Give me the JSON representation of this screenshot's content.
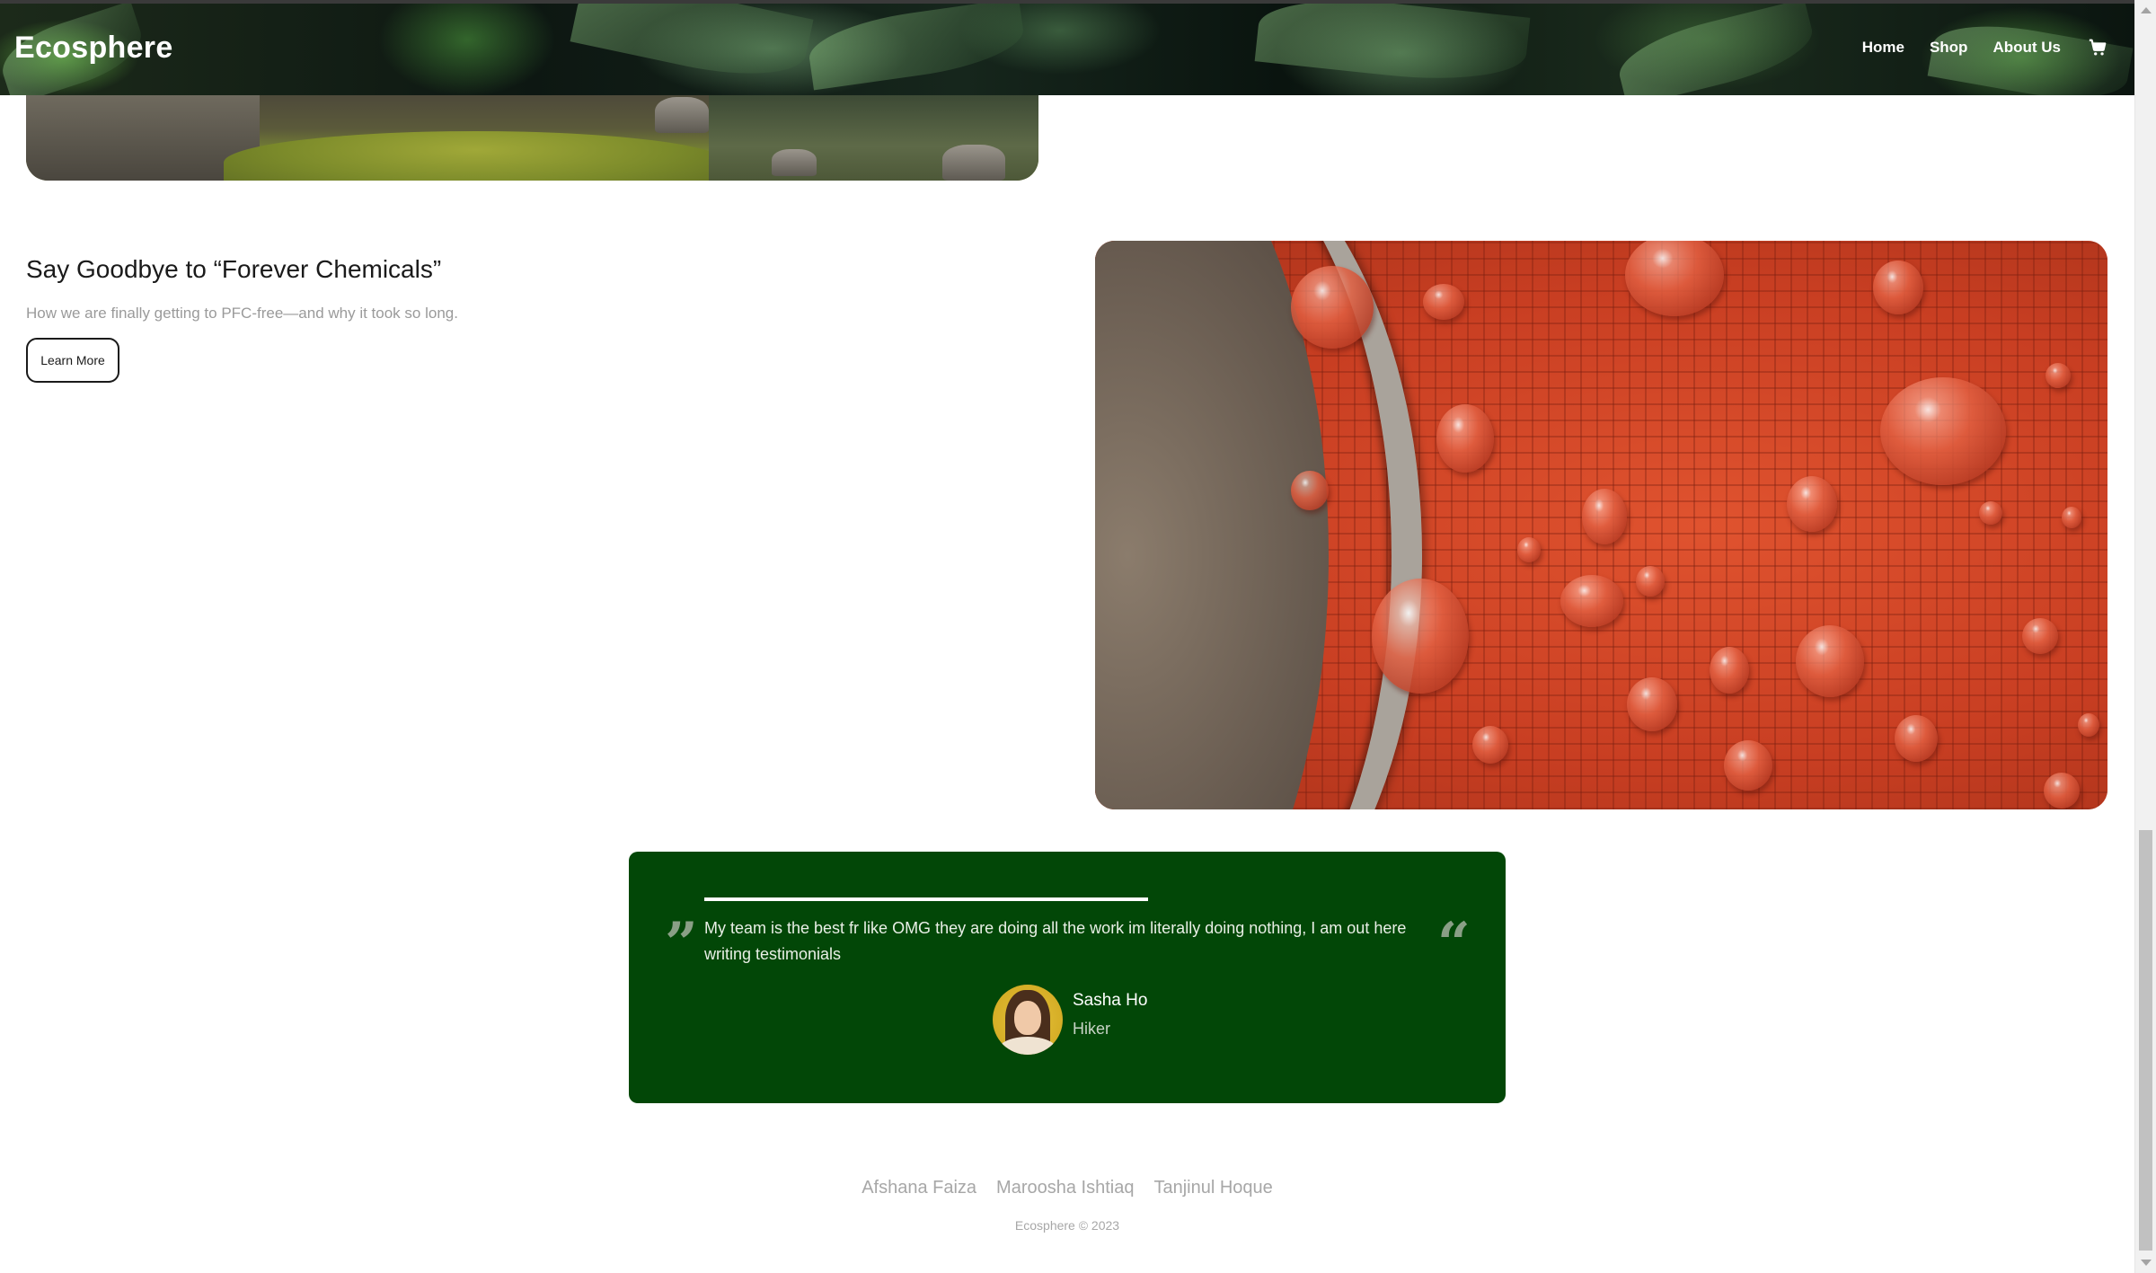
{
  "header": {
    "brand": "Ecosphere",
    "nav": {
      "home": "Home",
      "shop": "Shop",
      "about": "About Us"
    }
  },
  "icons": {
    "cart": "shopping-cart-icon",
    "quote_open": "quote-open-icon",
    "quote_close": "quote-close-icon"
  },
  "article": {
    "title": "Say Goodbye to “Forever Chemicals”",
    "subtitle": "How we are finally getting to PFC-free—and why it took so long.",
    "button_label": "Learn More"
  },
  "testimonial": {
    "quote": "My team is the best fr like OMG they are doing all the work im literally doing nothing, I am out here writing testimonials",
    "name": "Sasha Ho",
    "role": "Hiker",
    "quote_left_glyph": "”",
    "quote_right_glyph": "“"
  },
  "footer": {
    "authors": [
      "Afshana Faiza",
      "Maroosha Ishtiaq",
      "Tanjinul Hoque"
    ],
    "copyright": "Ecosphere © 2023"
  },
  "colors": {
    "testimonial_bg": "#024707",
    "footer_text": "#a7a7a7"
  }
}
